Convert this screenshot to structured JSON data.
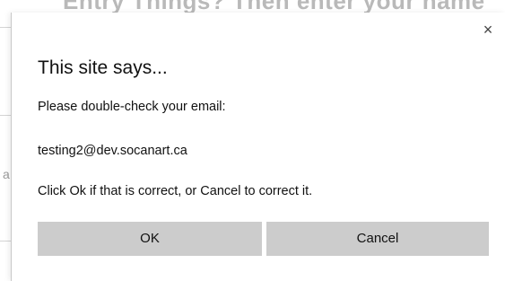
{
  "background": {
    "heading": "Entry Things? Then enter your name",
    "stray_char": "a"
  },
  "dialog": {
    "close_glyph": "×",
    "title": "This site says...",
    "line1": "Please double-check your email:",
    "email": "testing2@dev.socanart.ca",
    "line3": "Click Ok if that is correct, or Cancel to correct it.",
    "ok_label": "OK",
    "cancel_label": "Cancel"
  },
  "colors": {
    "button_bg": "#cccccc",
    "dialog_bg": "#ffffff",
    "text": "#111111"
  },
  "icons": {
    "close": "close-icon"
  }
}
